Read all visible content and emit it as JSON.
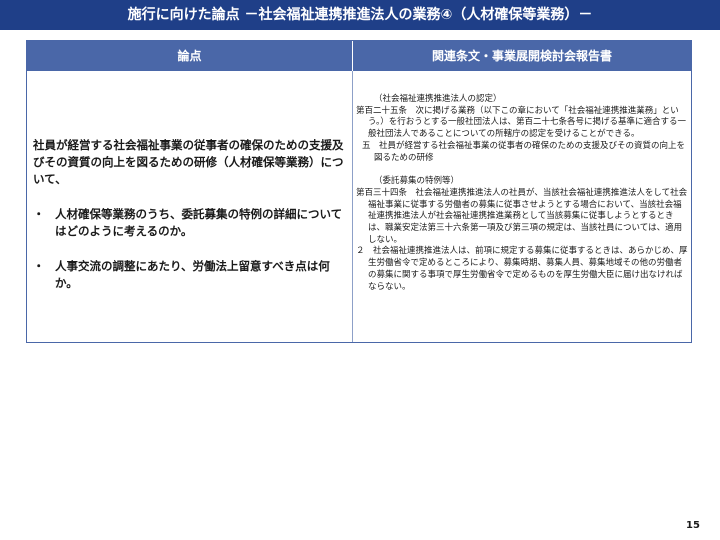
{
  "title": "施行に向けた論点 －社会福祉連携推進法人の業務④（人材確保等業務）－",
  "table": {
    "header_left": "論点",
    "header_right": "関連条文・事業展開検討会報告書"
  },
  "left": {
    "intro": "社員が経営する社会福祉事業の従事者の確保のための支援及びその資質の向上を図るための研修（人材確保等業務）について、",
    "bullet_symbol": "・",
    "bullets": [
      "人材確保等業務のうち、委託募集の特例の詳細についてはどのように考えるのか。",
      "人事交流の調整にあたり、労働法上留意すべき点は何か。"
    ]
  },
  "right": {
    "section1_heading": "（社会福祉連携推進法人の認定）",
    "section1_p1": "第百二十五条　次に掲げる業務（以下この章において「社会福祉連携推進業務」という。）を行おうとする一般社団法人は、第百二十七条各号に掲げる基準に適合する一般社団法人であることについての所轄庁の認定を受けることができる。",
    "section1_p2": "五　社員が経営する社会福祉事業の従事者の確保のための支援及びその資質の向上を図るための研修",
    "section2_heading": "（委託募集の特例等）",
    "section2_p1": "第百三十四条　社会福祉連携推進法人の社員が、当該社会福祉連携推進法人をして社会福祉事業に従事する労働者の募集に従事させようとする場合において、当該社会福祉連携推進法人が社会福祉連携推進業務として当該募集に従事しようとするときは、職業安定法第三十六条第一項及び第三項の規定は、当該社員については、適用しない。",
    "section2_p2": "２　社会福祉連携推進法人は、前項に規定する募集に従事するときは、あらかじめ、厚生労働省令で定めるところにより、募集時期、募集人員、募集地域その他の労働者の募集に関する事項で厚生労働省令で定めるものを厚生労働大臣に届け出なければならない。"
  },
  "page_number": "15",
  "colors": {
    "title_bar": "#1f3f88",
    "table_header": "#4a67a8"
  }
}
